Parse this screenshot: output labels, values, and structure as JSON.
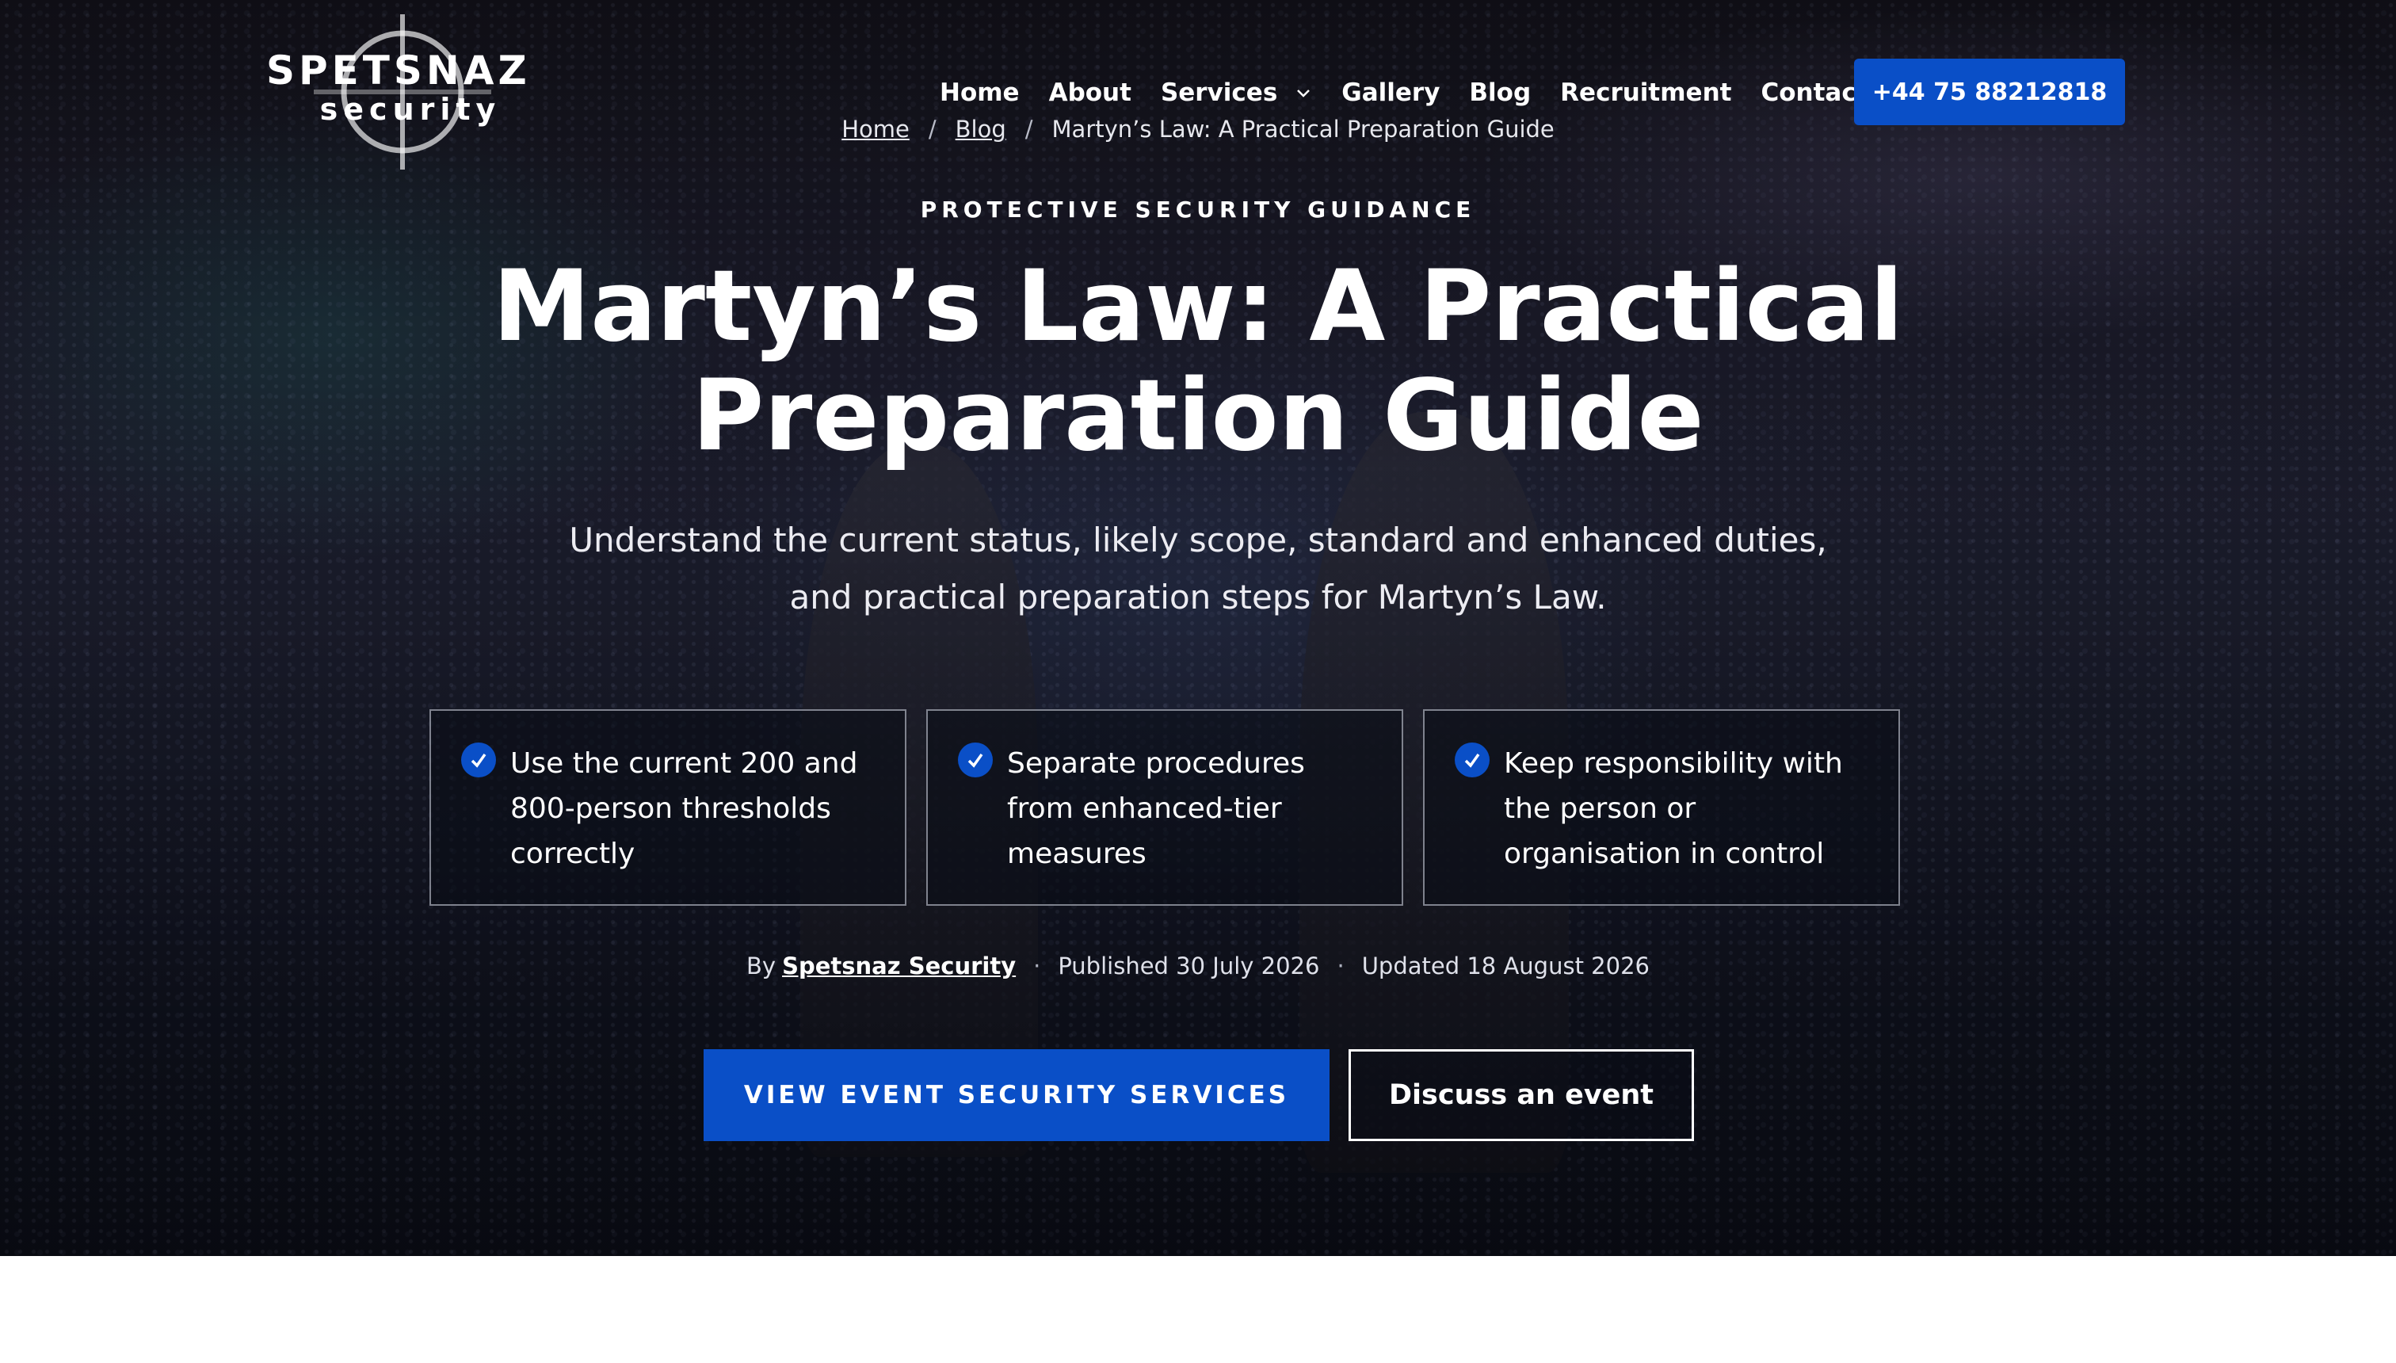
{
  "brand": {
    "name": "SPETSNAZ",
    "sub": "security"
  },
  "nav": {
    "items": [
      "Home",
      "About",
      "Services",
      "Gallery",
      "Blog",
      "Recruitment",
      "Contact"
    ],
    "phone": "+44 75 88212818"
  },
  "breadcrumb": {
    "home": "Home",
    "sep": "/",
    "blog": "Blog",
    "current": "Martyn’s Law: A Practical Preparation Guide"
  },
  "hero": {
    "eyebrow": "PROTECTIVE SECURITY GUIDANCE",
    "title": "Martyn’s Law: A Practical Preparation Guide",
    "lede": "Understand the current status, likely scope, standard and enhanced duties, and practical preparation steps for Martyn’s Law.",
    "cards": [
      "Use the current 200 and 800-person thresholds correctly",
      "Separate procedures from enhanced-tier measures",
      "Keep responsibility with the person or organisation in control"
    ]
  },
  "meta": {
    "by": "By",
    "author": "Spetsnaz Security",
    "published": "Published 30 July 2026",
    "updated": "Updated 18 August 2026",
    "dot": "·"
  },
  "cta": {
    "primary": "VIEW EVENT SECURITY SERVICES",
    "secondary": "Discuss an event"
  },
  "colors": {
    "accent": "#0a4fc7",
    "text": "#ffffff",
    "hero_bg": "#171826"
  }
}
